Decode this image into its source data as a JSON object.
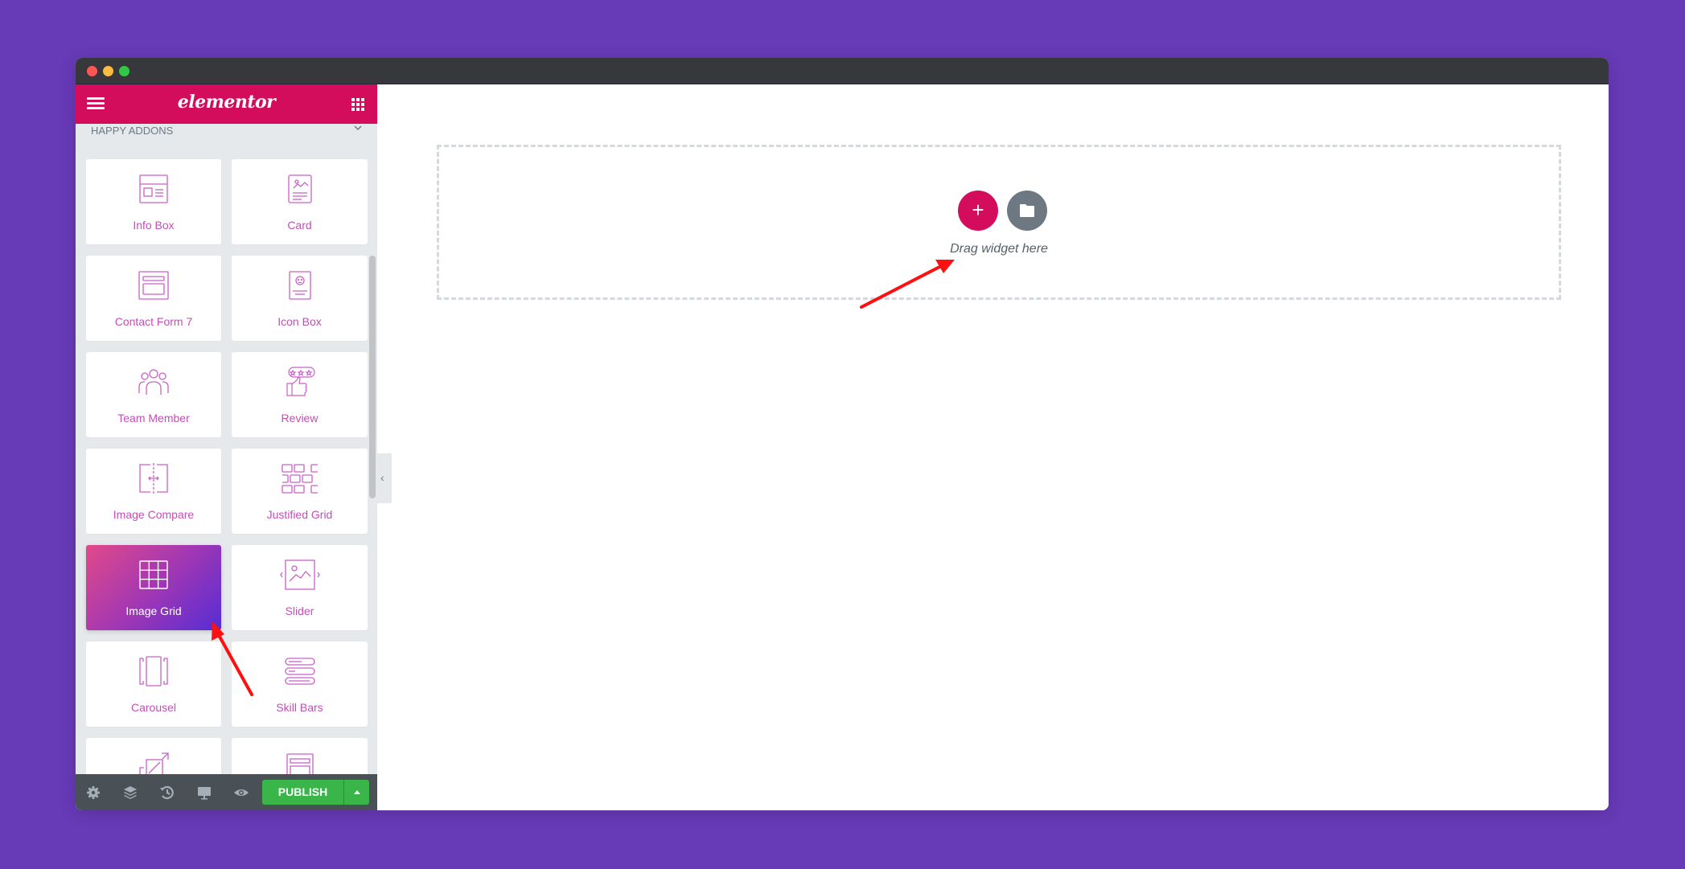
{
  "window": {
    "controls": [
      "close",
      "minimize",
      "maximize"
    ]
  },
  "sidebar": {
    "logo": "elementor",
    "menu_icon": "hamburger-menu-icon",
    "apps_icon": "apps-grid-icon",
    "section_title": "HAPPY ADDONS",
    "widgets": [
      {
        "label": "Info Box",
        "icon": "info-box-icon",
        "active": false
      },
      {
        "label": "Card",
        "icon": "card-icon",
        "active": false
      },
      {
        "label": "Contact Form 7",
        "icon": "contact-form-icon",
        "active": false
      },
      {
        "label": "Icon Box",
        "icon": "icon-box-icon",
        "active": false
      },
      {
        "label": "Team Member",
        "icon": "team-member-icon",
        "active": false
      },
      {
        "label": "Review",
        "icon": "review-icon",
        "active": false
      },
      {
        "label": "Image Compare",
        "icon": "image-compare-icon",
        "active": false
      },
      {
        "label": "Justified Grid",
        "icon": "justified-grid-icon",
        "active": false
      },
      {
        "label": "Image Grid",
        "icon": "image-grid-icon",
        "active": true
      },
      {
        "label": "Slider",
        "icon": "slider-icon",
        "active": false
      },
      {
        "label": "Carousel",
        "icon": "carousel-icon",
        "active": false
      },
      {
        "label": "Skill Bars",
        "icon": "skill-bars-icon",
        "active": false
      },
      {
        "label": "",
        "icon": "scale-icon",
        "active": false
      },
      {
        "label": "",
        "icon": "layout-icon",
        "active": false
      }
    ],
    "footer": {
      "icons": [
        "settings-icon",
        "navigator-layers-icon",
        "history-icon",
        "responsive-desktop-icon",
        "preview-eye-icon"
      ],
      "publish_label": "PUBLISH"
    }
  },
  "canvas": {
    "drop_hint": "Drag widget here",
    "add_section_icon": "plus-icon",
    "add_template_icon": "folder-icon"
  },
  "colors": {
    "background": "#673ab7",
    "brand": "#d30c5c",
    "publish": "#39b54a",
    "widget_icon": "#c04fb6",
    "annotation_arrow": "#ff0000"
  }
}
